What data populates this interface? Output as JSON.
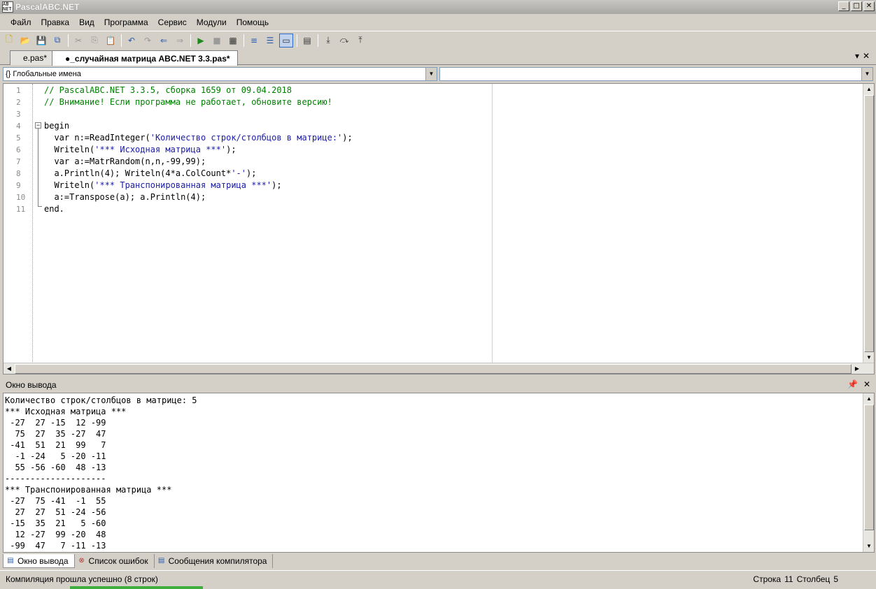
{
  "window": {
    "title": "PascalABC.NET",
    "icon_text": "AB\nNET"
  },
  "menu": [
    "Файл",
    "Правка",
    "Вид",
    "Программа",
    "Сервис",
    "Модули",
    "Помощь"
  ],
  "toolbar": {
    "icons": [
      "new-file-icon",
      "open-icon",
      "save-icon",
      "save-all-icon",
      "cut-icon",
      "copy-icon",
      "paste-icon",
      "undo-icon",
      "redo-icon",
      "navigate-back-icon",
      "navigate-forward-icon",
      "run-icon",
      "stop-icon",
      "debug-icon",
      "comment-icon",
      "uncomment-icon",
      "output-window-icon",
      "form-icon",
      "step-into-icon",
      "step-over-icon",
      "step-out-icon"
    ]
  },
  "tabs": [
    {
      "label": "e.pas*",
      "active": false
    },
    {
      "label": "●_случайная матрица ABC.NET 3.3.pas*",
      "active": true
    }
  ],
  "scope_combo": {
    "value": "{} Глобальные имена"
  },
  "member_combo": {
    "value": ""
  },
  "editor": {
    "line_numbers": [
      "1",
      "2",
      "3",
      "4",
      "5",
      "6",
      "7",
      "8",
      "9",
      "10",
      "11"
    ],
    "lines": [
      {
        "indent": "",
        "parts": [
          {
            "t": "// PascalABC.NET 3.3.5, сборка 1659 от 09.04.2018",
            "c": "comment"
          }
        ]
      },
      {
        "indent": "",
        "parts": [
          {
            "t": "// Внимание! Если программа не работает, обновите версию!",
            "c": "comment"
          }
        ]
      },
      {
        "indent": "",
        "parts": []
      },
      {
        "indent": "",
        "parts": [
          {
            "t": "begin",
            "c": ""
          }
        ]
      },
      {
        "indent": "  ",
        "parts": [
          {
            "t": "var n:=ReadInteger(",
            "c": ""
          },
          {
            "t": "'Количество строк/столбцов в матрице:'",
            "c": "str"
          },
          {
            "t": ");",
            "c": ""
          }
        ]
      },
      {
        "indent": "  ",
        "parts": [
          {
            "t": "Writeln(",
            "c": ""
          },
          {
            "t": "'*** Исходная матрица ***'",
            "c": "str"
          },
          {
            "t": ");",
            "c": ""
          }
        ]
      },
      {
        "indent": "  ",
        "parts": [
          {
            "t": "var a:=MatrRandom(n,n,-99,99);",
            "c": ""
          }
        ]
      },
      {
        "indent": "  ",
        "parts": [
          {
            "t": "a.Println(4); Writeln(4*a.ColCount*",
            "c": ""
          },
          {
            "t": "'-'",
            "c": "str"
          },
          {
            "t": ");",
            "c": ""
          }
        ]
      },
      {
        "indent": "  ",
        "parts": [
          {
            "t": "Writeln(",
            "c": ""
          },
          {
            "t": "'*** Транспонированная матрица ***'",
            "c": "str"
          },
          {
            "t": ");",
            "c": ""
          }
        ]
      },
      {
        "indent": "  ",
        "parts": [
          {
            "t": "a:=Transpose(a); a.Println(4);",
            "c": ""
          }
        ]
      },
      {
        "indent": "",
        "parts": [
          {
            "t": "end.",
            "c": ""
          }
        ]
      }
    ]
  },
  "output_panel": {
    "title": "Окно вывода",
    "lines": [
      "Количество строк/столбцов в матрице: 5",
      "*** Исходная матрица ***",
      " -27  27 -15  12 -99",
      "  75  27  35 -27  47",
      " -41  51  21  99   7",
      "  -1 -24   5 -20 -11",
      "  55 -56 -60  48 -13",
      "--------------------",
      "*** Транспонированная матрица ***",
      " -27  75 -41  -1  55",
      "  27  27  51 -24 -56",
      " -15  35  21   5 -60",
      "  12 -27  99 -20  48",
      " -99  47   7 -11 -13"
    ]
  },
  "bottom_tabs": [
    {
      "label": "Окно вывода",
      "icon": "output-window-icon",
      "active": true
    },
    {
      "label": "Список ошибок",
      "icon": "error-list-icon",
      "active": false
    },
    {
      "label": "Сообщения компилятора",
      "icon": "compiler-messages-icon",
      "active": false
    }
  ],
  "status": {
    "message": "Компиляция прошла успешно (8 строк)",
    "row_label": "Строка",
    "row_value": "11",
    "col_label": "Столбец",
    "col_value": "5"
  }
}
